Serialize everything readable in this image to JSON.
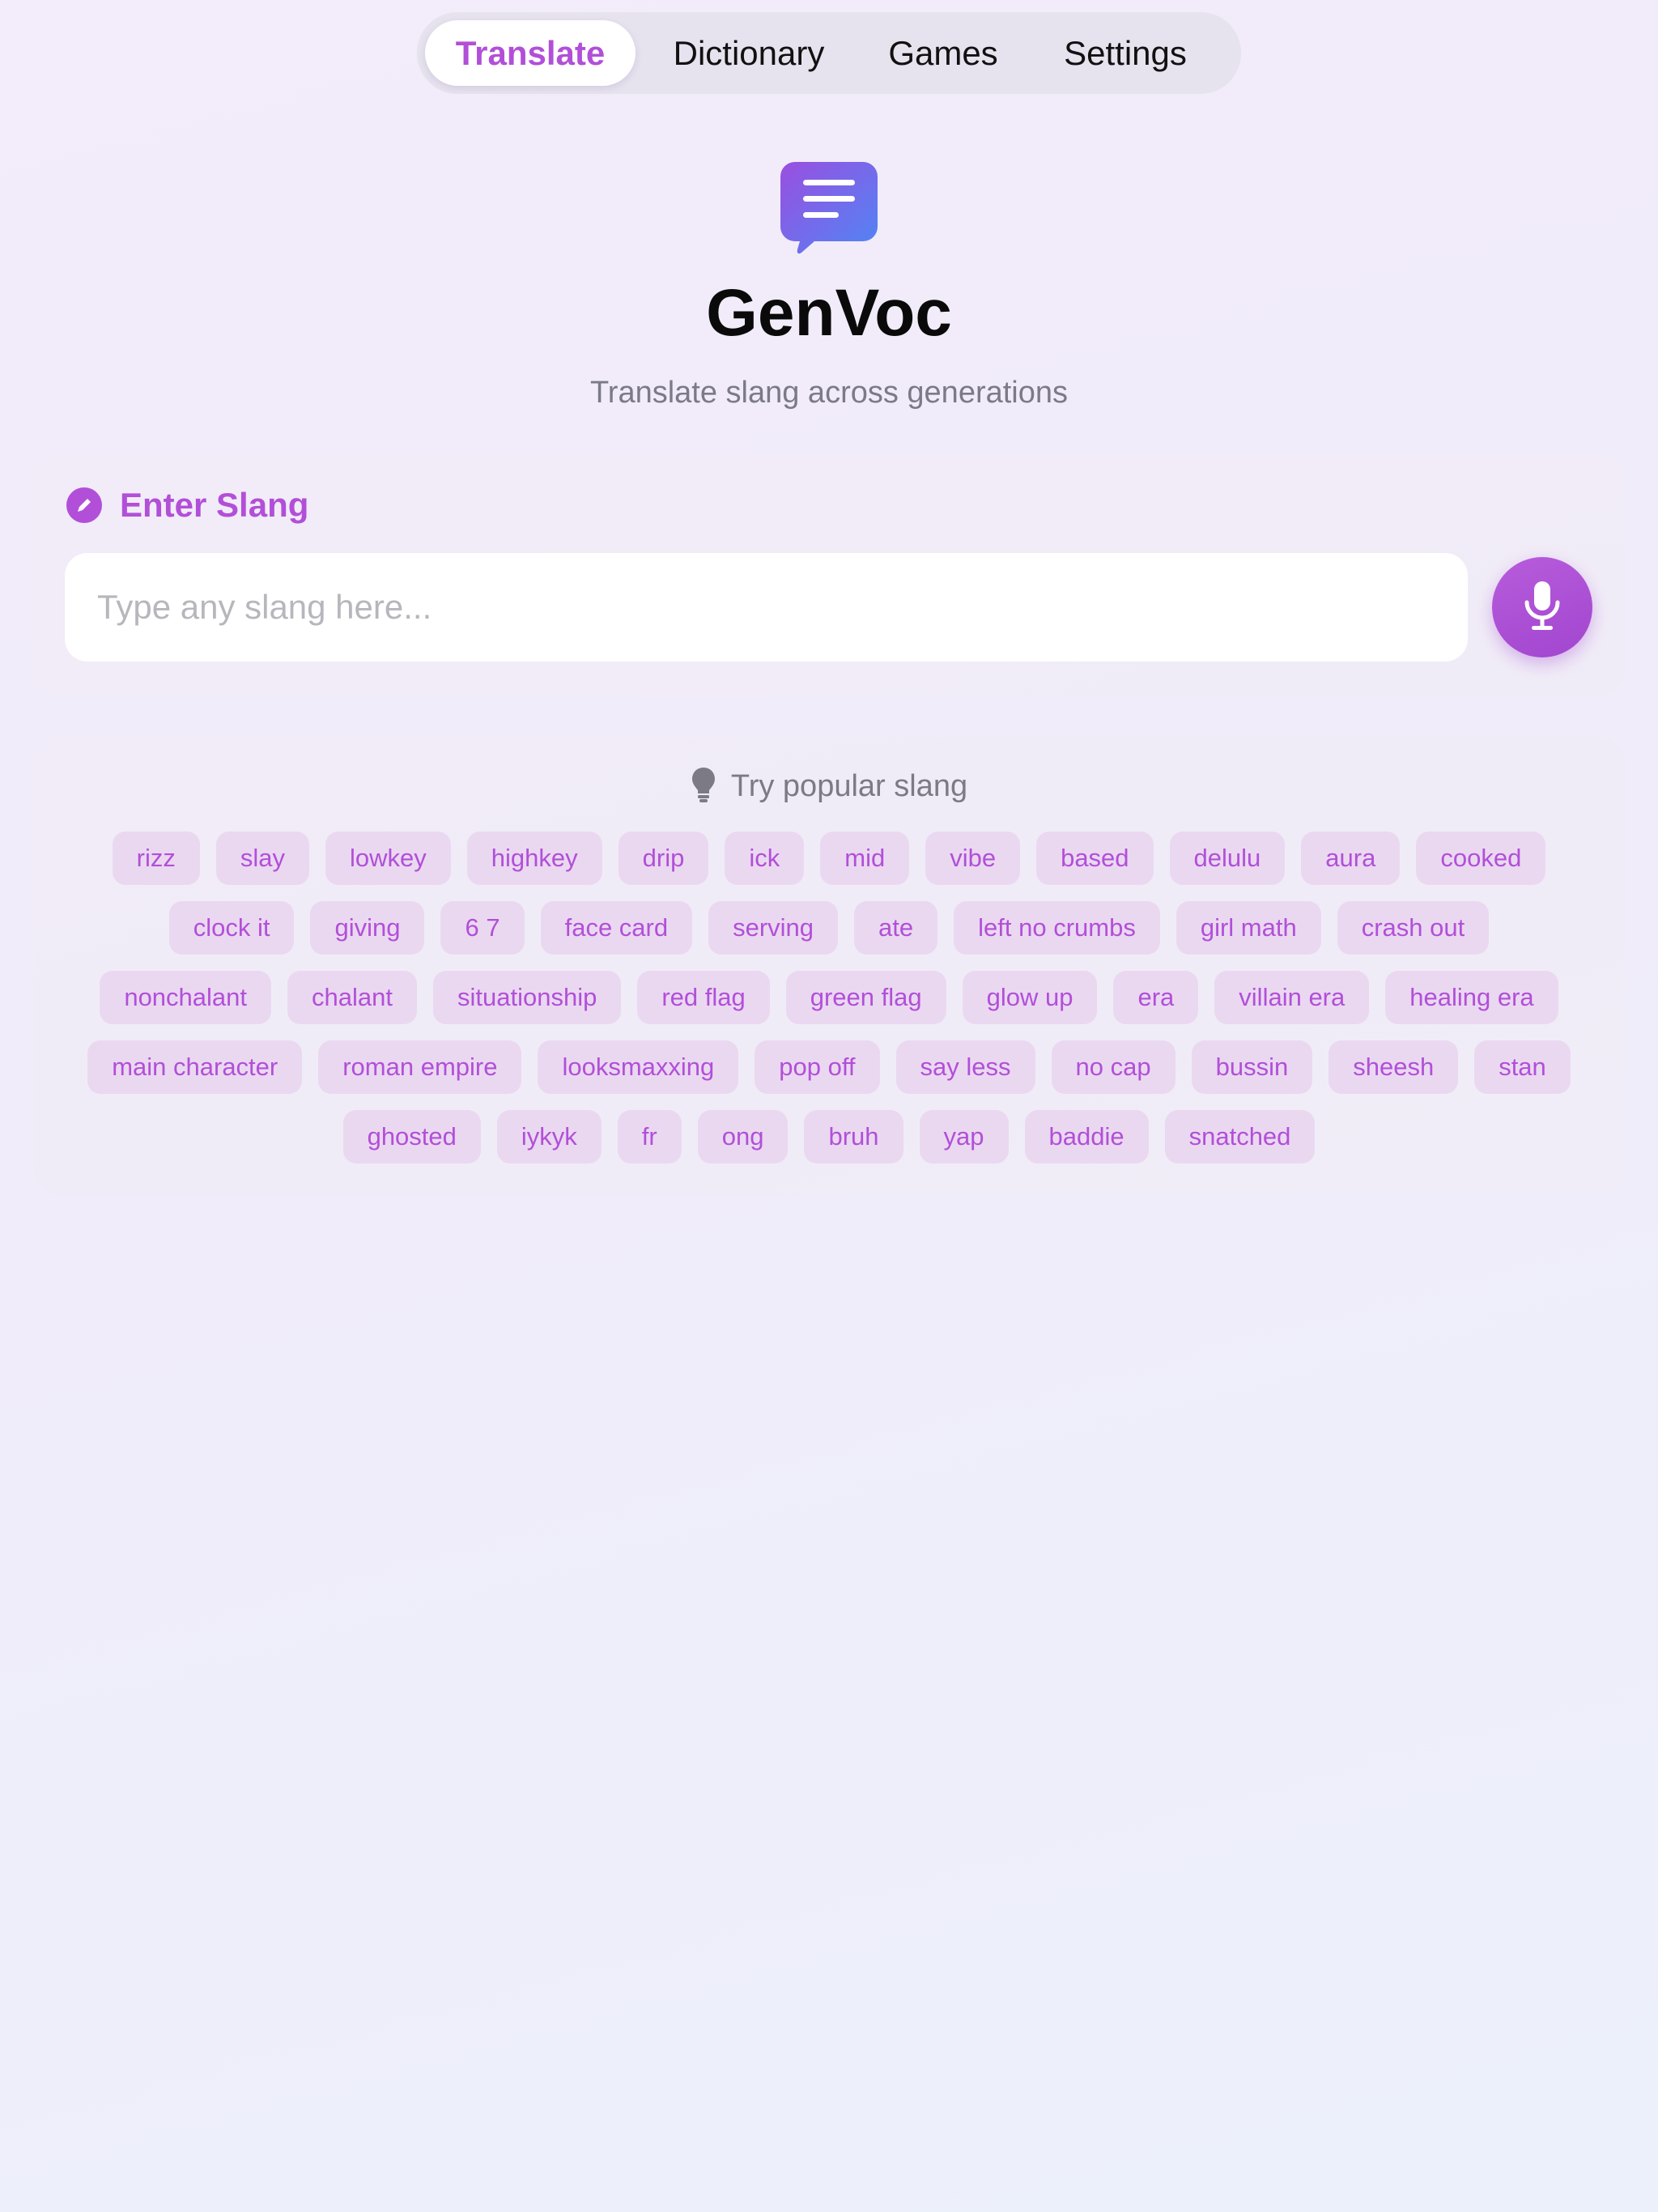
{
  "tabs": [
    {
      "label": "Translate",
      "active": true
    },
    {
      "label": "Dictionary",
      "active": false
    },
    {
      "label": "Games",
      "active": false
    },
    {
      "label": "Settings",
      "active": false
    }
  ],
  "hero": {
    "icon": "chat-bubble-icon",
    "title": "GenVoc",
    "subtitle": "Translate slang across generations"
  },
  "input_section": {
    "icon": "pencil-icon",
    "label": "Enter Slang",
    "placeholder": "Type any slang here...",
    "value": "",
    "mic_icon": "microphone-icon"
  },
  "popular": {
    "icon": "lightbulb-icon",
    "label": "Try popular slang",
    "rows": [
      [
        "rizz",
        "slay",
        "lowkey",
        "highkey",
        "drip",
        "ick",
        "mid",
        "vibe",
        "based",
        "delulu",
        "aura",
        "cooked"
      ],
      [
        "clock it",
        "giving",
        "6 7",
        "face card",
        "serving",
        "ate",
        "left no crumbs",
        "girl math",
        "crash out"
      ],
      [
        "nonchalant",
        "chalant",
        "situationship",
        "red flag",
        "green flag",
        "glow up",
        "era",
        "villain era",
        "healing era"
      ],
      [
        "main character",
        "roman empire",
        "looksmaxxing",
        "pop off",
        "say less",
        "no cap",
        "bussin",
        "sheesh",
        "stan"
      ],
      [
        "ghosted",
        "iykyk",
        "fr",
        "ong",
        "bruh",
        "yap",
        "baddie",
        "snatched"
      ]
    ]
  },
  "colors": {
    "accent": "#b24fd8",
    "chip_bg": "#ead8f1",
    "logo_gradient_start": "#9a4fe0",
    "logo_gradient_end": "#4f86f5"
  }
}
